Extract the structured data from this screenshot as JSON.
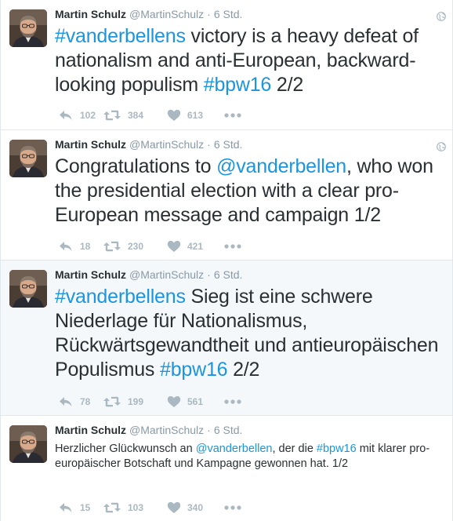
{
  "tweets": [
    {
      "name": "Martin Schulz",
      "handle": "@MartinSchulz",
      "separator": "·",
      "time": "6 Std.",
      "text_parts": [
        {
          "t": "#vanderbellens",
          "link": true
        },
        {
          "t": " victory is a heavy defeat of nationalism and anti-European, backward-looking populism ",
          "link": false
        },
        {
          "t": "#bpw16",
          "link": true
        },
        {
          "t": " 2/2",
          "link": false
        }
      ],
      "replies": "102",
      "retweets": "384",
      "likes": "613",
      "highlighted": false
    },
    {
      "name": "Martin Schulz",
      "handle": "@MartinSchulz",
      "separator": "·",
      "time": "6 Std.",
      "text_parts": [
        {
          "t": "Congratulations to ",
          "link": false
        },
        {
          "t": "@vanderbellen",
          "link": true
        },
        {
          "t": ", who won the presidential election with a clear pro-European message and campaign 1/2",
          "link": false
        }
      ],
      "replies": "18",
      "retweets": "230",
      "likes": "421",
      "highlighted": false
    },
    {
      "name": "Martin Schulz",
      "handle": "@MartinSchulz",
      "separator": "·",
      "time": "6 Std.",
      "text_parts": [
        {
          "t": "#vanderbellens",
          "link": true
        },
        {
          "t": " Sieg ist eine schwere Niederlage für Nationalismus, Rückwärtsgewandtheit und antieuropäischen Populismus ",
          "link": false
        },
        {
          "t": "#bpw16",
          "link": true
        },
        {
          "t": " 2/2",
          "link": false
        }
      ],
      "replies": "78",
      "retweets": "199",
      "likes": "561",
      "highlighted": true
    },
    {
      "name": "Martin Schulz",
      "handle": "@MartinSchulz",
      "separator": "·",
      "time": "6 Std.",
      "text_parts": [
        {
          "t": "Herzlicher Glückwunsch an ",
          "link": false
        },
        {
          "t": "@vanderbellen",
          "link": true
        },
        {
          "t": ", der die ",
          "link": false
        },
        {
          "t": "#bpw16",
          "link": true
        },
        {
          "t": " mit klarer pro-europäischer Botschaft und Kampagne gewonnen hat. 1/2",
          "link": false
        }
      ],
      "replies": "15",
      "retweets": "103",
      "likes": "340",
      "highlighted": false
    }
  ],
  "icons": {
    "reply": "reply-icon",
    "retweet": "retweet-icon",
    "like": "heart-icon",
    "more": "more-icon",
    "globe": "globe-icon"
  },
  "colors": {
    "link": "#1b95e0",
    "meta": "#8899a6",
    "action": "#aab8c2",
    "highlight_bg": "#f5f8fa",
    "border": "#e1e8ed"
  }
}
